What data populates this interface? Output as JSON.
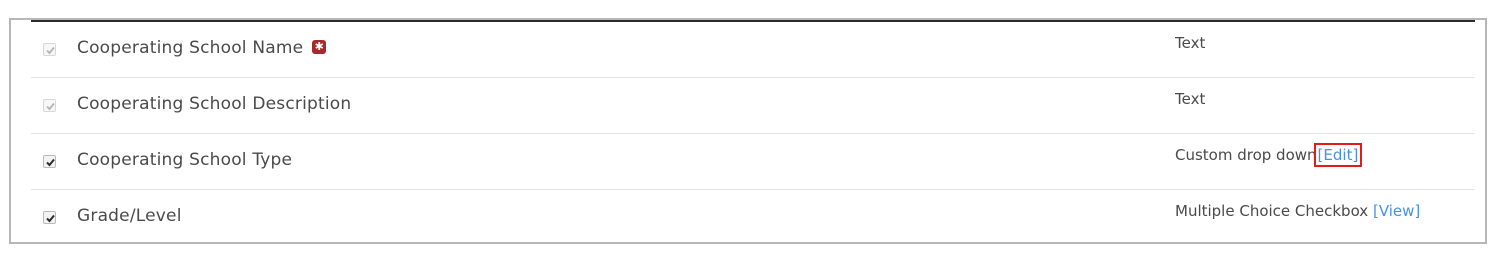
{
  "fields": [
    {
      "label": "Cooperating School Name",
      "type": "Text",
      "checked": true,
      "disabled": true,
      "required": true,
      "required_icon": "asterisk-icon"
    },
    {
      "label": "Cooperating School Description",
      "type": "Text",
      "checked": true,
      "disabled": true,
      "required": false
    },
    {
      "label": "Cooperating School Type",
      "type": "Custom drop down",
      "checked": true,
      "disabled": false,
      "required": false,
      "link": "[Edit]"
    },
    {
      "label": "Grade/Level",
      "type": "Multiple Choice Checkbox",
      "checked": true,
      "disabled": false,
      "required": false,
      "link": "[View]"
    }
  ],
  "colors": {
    "link": "#4a90e2",
    "required_badge": "#a52a2a",
    "highlight_box": "#e31b1b"
  }
}
